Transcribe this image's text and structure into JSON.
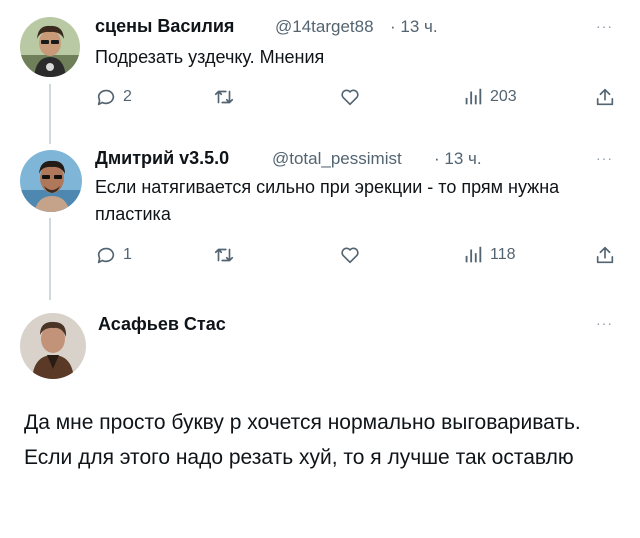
{
  "tweets": [
    {
      "name": "сцены Василия",
      "handle": "@14target88",
      "time": "· 13 ч.",
      "more": "···",
      "text": "Подрезать уздечку. Мнения",
      "replies": "2",
      "retweets": "",
      "likes": "",
      "views": "203"
    },
    {
      "name": "Дмитрий v3.5.0",
      "handle": "@total_pessimist",
      "time": "· 13 ч.",
      "more": "···",
      "text": "Если натягивается сильно при эрекции - то прям нужна пластика",
      "replies": "1",
      "retweets": "",
      "likes": "",
      "views": "118"
    }
  ],
  "reply": {
    "name": "Асафьев Стас",
    "more": "···",
    "text": "Да мне просто букву р хочется нормально выговаривать. Если для этого надо резать хуй, то я лучше так оставлю"
  },
  "colors": {
    "text": "#0f1419",
    "secondary": "#536471",
    "thread_line": "#cfd9de"
  },
  "icons": [
    "reply-icon",
    "retweet-icon",
    "like-icon",
    "views-icon",
    "share-icon",
    "more-icon"
  ]
}
